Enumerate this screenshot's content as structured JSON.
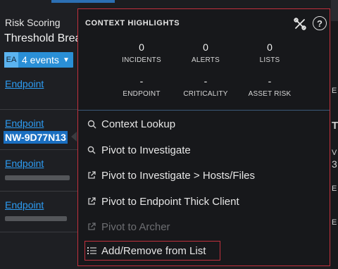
{
  "left_panel": {
    "title": "Risk Scoring",
    "subtitle": "Threshold Breac",
    "events_badge": {
      "prefix": "EA",
      "label": "4 events"
    },
    "endpoint_label": "Endpoint",
    "selected_host": "NW-9D77N13"
  },
  "popover": {
    "header": "CONTEXT HIGHLIGHTS",
    "stats_row1": [
      {
        "value": "0",
        "label": "INCIDENTS"
      },
      {
        "value": "0",
        "label": "ALERTS"
      },
      {
        "value": "0",
        "label": "LISTS"
      }
    ],
    "stats_row2": [
      {
        "value": "-",
        "label": "ENDPOINT"
      },
      {
        "value": "-",
        "label": "CRITICALITY"
      },
      {
        "value": "-",
        "label": "ASSET RISK"
      }
    ],
    "menu": [
      {
        "label": "Context Lookup",
        "icon": "context-lookup-icon",
        "enabled": true
      },
      {
        "label": "Pivot to Investigate",
        "icon": "search-icon",
        "enabled": true
      },
      {
        "label": "Pivot to Investigate > Hosts/Files",
        "icon": "external-link-icon",
        "enabled": true
      },
      {
        "label": "Pivot to Endpoint Thick Client",
        "icon": "external-link-icon",
        "enabled": true
      },
      {
        "label": "Pivot to Archer",
        "icon": "external-link-icon",
        "enabled": false
      },
      {
        "label": "Add/Remove from List",
        "icon": "list-icon",
        "enabled": true
      }
    ]
  },
  "right_panel": {
    "fragments": [
      "E",
      "T",
      "V",
      "3",
      "E",
      "E"
    ]
  },
  "colors": {
    "accent_blue": "#2a8fd6",
    "link_blue": "#2d9cf3",
    "highlight_red": "#c2303d",
    "background": "#1c1d20"
  }
}
